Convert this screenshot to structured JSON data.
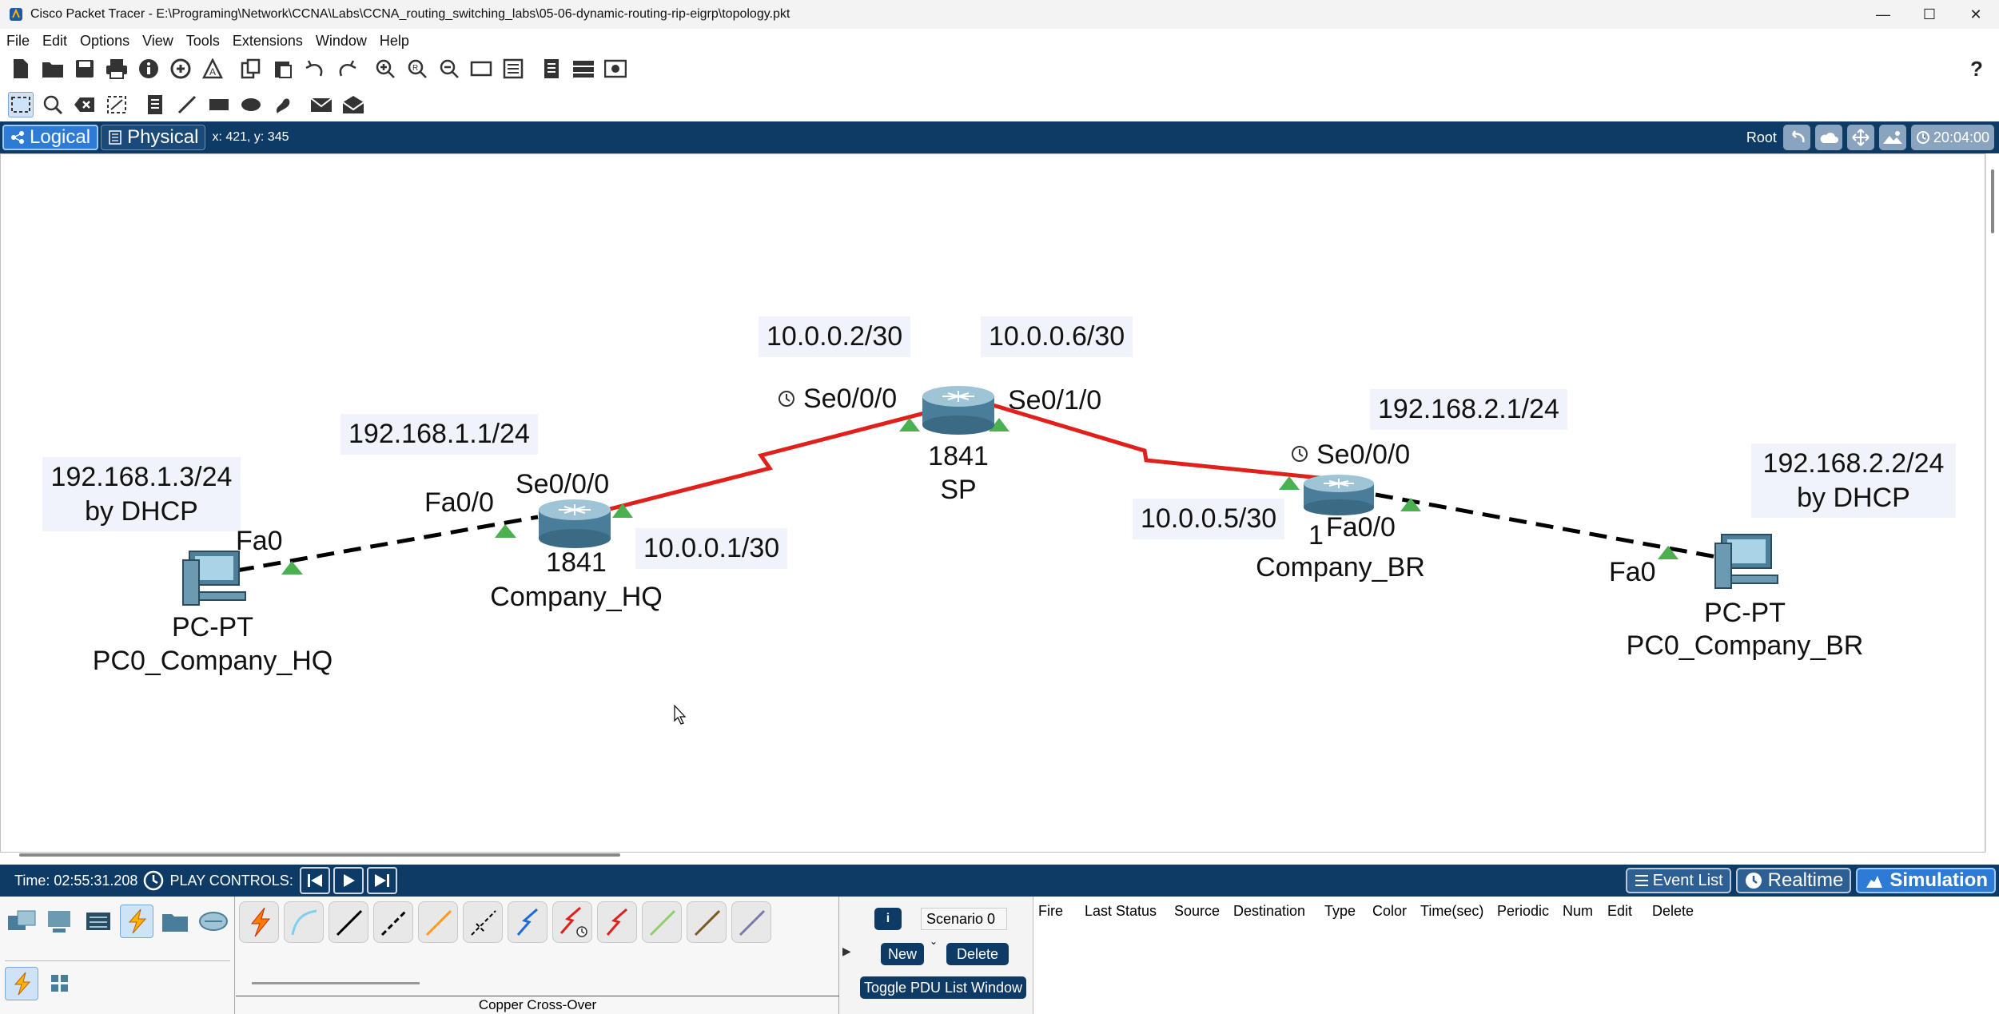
{
  "window": {
    "title": "Cisco Packet Tracer - E:\\Programing\\Network\\CCNA\\Labs\\CCNA_routing_switching_labs\\05-06-dynamic-routing-rip-eigrp\\topology.pkt",
    "controls": [
      "—",
      "☐",
      "✕"
    ]
  },
  "menu": [
    "File",
    "Edit",
    "Options",
    "View",
    "Tools",
    "Extensions",
    "Window",
    "Help"
  ],
  "modebar": {
    "logical": "Logical",
    "physical": "Physical",
    "coords": "x: 421, y: 345",
    "root": "Root",
    "clock": "20:04:00"
  },
  "topology": {
    "pc_hq": {
      "ip": "192.168.1.3/24\nby DHCP",
      "port": "Fa0",
      "model": "PC-PT",
      "name": "PC0_Company_HQ"
    },
    "router_hq": {
      "ip": "192.168.1.1/24",
      "fa_port": "Fa0/0",
      "se_port": "Se0/0/0",
      "model": "1841",
      "name": "Company_HQ",
      "serial_ip": "10.0.0.1/30"
    },
    "router_sp": {
      "left_ip": "10.0.0.2/30",
      "right_ip": "10.0.0.6/30",
      "left_port": "Se0/0/0",
      "right_port": "Se0/1/0",
      "model": "1841",
      "name": "SP"
    },
    "router_br": {
      "ip": "192.168.2.1/24",
      "se_port": "Se0/0/0",
      "fa_port": "Fa0/0",
      "serial_ip": "10.0.0.5/30",
      "model_partial": "1",
      "name": "Company_BR"
    },
    "pc_br": {
      "ip": "192.168.2.2/24\nby DHCP",
      "port": "Fa0",
      "model": "PC-PT",
      "name": "PC0_Company_BR"
    }
  },
  "playbar": {
    "time": "Time: 02:55:31.208",
    "controls_label": "PLAY CONTROLS:",
    "event_list": "Event List",
    "realtime": "Realtime",
    "simulation": "Simulation"
  },
  "connections": {
    "caption": "Copper Cross-Over"
  },
  "scenario": {
    "selected": "Scenario 0",
    "new": "New",
    "delete": "Delete",
    "toggle": "Toggle PDU List Window"
  },
  "pdu_columns": [
    "Fire",
    "Last Status",
    "Source",
    "Destination",
    "Type",
    "Color",
    "Time(sec)",
    "Periodic",
    "Num",
    "Edit",
    "Delete"
  ],
  "colors": {
    "serial_link": "#e0201a",
    "ethernet_link": "#000000",
    "link_up": "#4caf50",
    "bar_navy": "#0d3b66",
    "accent_blue": "#2e7bd6"
  }
}
